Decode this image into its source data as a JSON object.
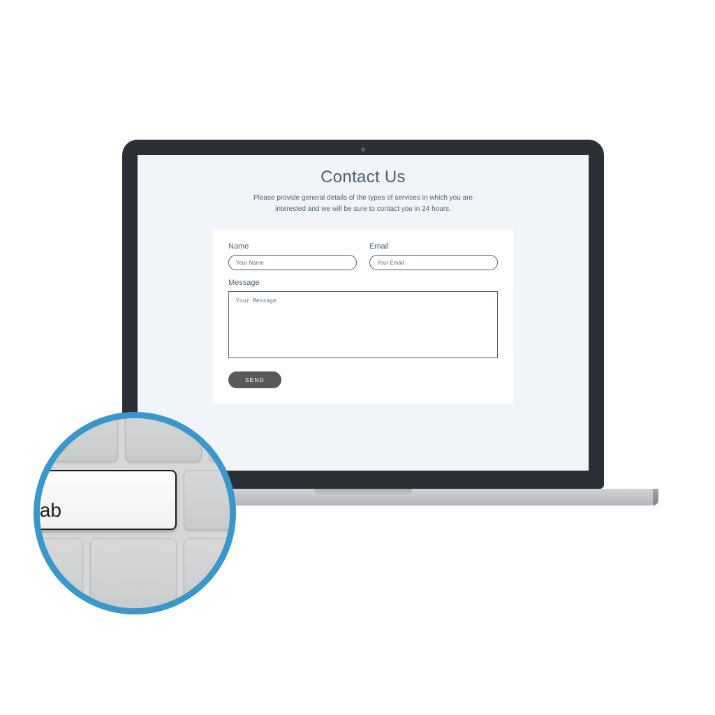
{
  "page": {
    "title": "Contact Us",
    "subtitle": "Please provide general details of the types of services in which you are interested and we will be sure to contact you in 24 hours."
  },
  "form": {
    "name": {
      "label": "Name",
      "placeholder": "Your Name"
    },
    "email": {
      "label": "Email",
      "placeholder": "Your Email"
    },
    "message": {
      "label": "Message",
      "placeholder": "Your Message"
    },
    "send_label": "SEND"
  },
  "keyboard": {
    "tab_label": "tab"
  }
}
